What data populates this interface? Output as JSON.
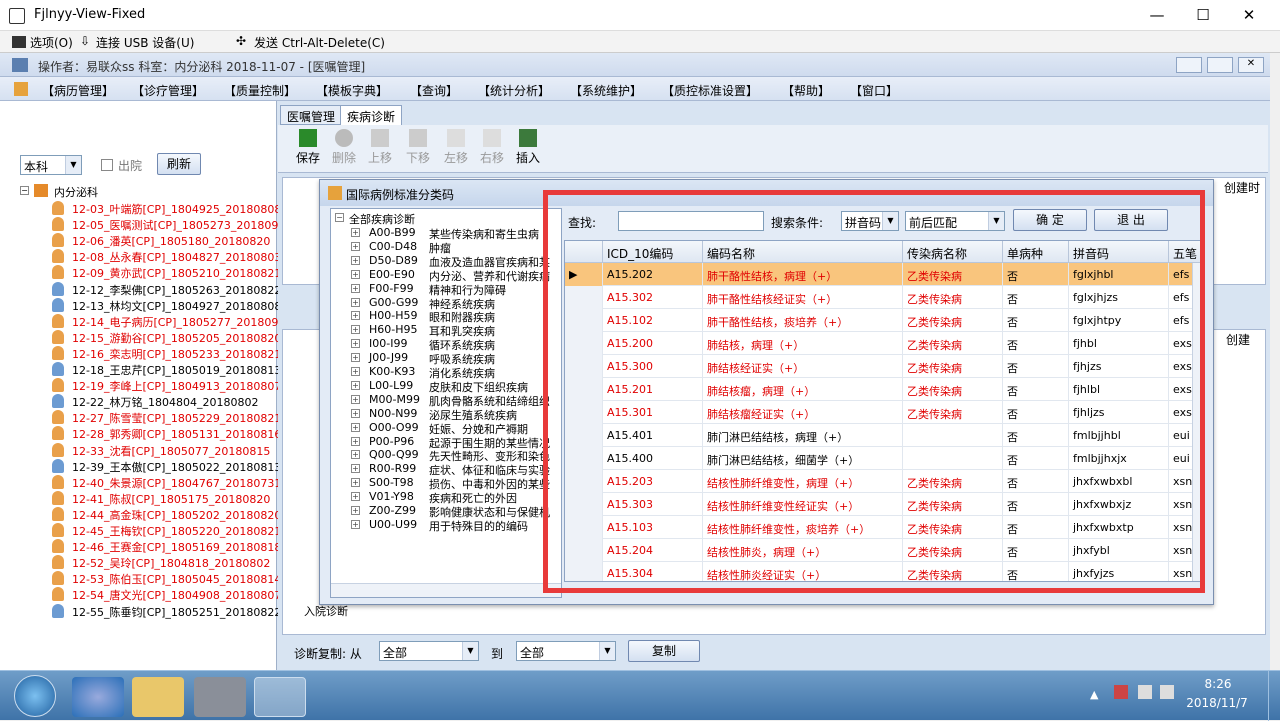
{
  "window": {
    "title": "Fjlnyy-View-Fixed",
    "min": "—",
    "max": "☐",
    "close": "✕"
  },
  "vnc": {
    "options": "选项(O)",
    "usb": "连接 USB 设备(U)",
    "cad": "发送 Ctrl-Alt-Delete(C)"
  },
  "info": {
    "text": "操作者：易联众ss   科室：内分泌科   2018-11-07 - [医嘱管理]"
  },
  "menu": [
    "【病历管理】",
    "【诊疗管理】",
    "【质量控制】",
    "【模板字典】",
    "【查询】",
    "【统计分析】",
    "【系统维护】",
    "【质控标准设置】",
    "【帮助】",
    "【窗口】"
  ],
  "left": {
    "dept_select": "本科",
    "discharged_label": "出院",
    "refresh_label": "刷新",
    "root": "内分泌科",
    "patients": [
      {
        "text": "12-03_叶端筋[CP]_1804925_20180808",
        "red": true
      },
      {
        "text": "12-05_医嘱测试[CP]_1805273_201809",
        "red": true
      },
      {
        "text": "12-06_潘英[CP]_1805180_20180820",
        "red": true
      },
      {
        "text": "12-08_丛永春[CP]_1804827_20180803",
        "red": true
      },
      {
        "text": "12-09_黄亦武[CP]_1805210_20180821",
        "red": true
      },
      {
        "text": "12-12_李梨佛[CP]_1805263_20180822",
        "red": false
      },
      {
        "text": "12-13_林均文[CP]_1804927_20180808",
        "red": false
      },
      {
        "text": "12-14_电子病历[CP]_1805277_201809",
        "red": true
      },
      {
        "text": "12-15_游勤谷[CP]_1805205_20180820",
        "red": true
      },
      {
        "text": "12-16_栾志明[CP]_1805233_20180821",
        "red": true
      },
      {
        "text": "12-18_王忠芹[CP]_1805019_20180813",
        "red": false
      },
      {
        "text": "12-19_李峰上[CP]_1804913_20180807",
        "red": true
      },
      {
        "text": "12-22_林万铭_1804804_20180802",
        "red": false
      },
      {
        "text": "12-27_陈雪莹[CP]_1805229_20180821",
        "red": true
      },
      {
        "text": "12-28_郭秀卿[CP]_1805131_20180816",
        "red": true
      },
      {
        "text": "12-33_沈看[CP]_1805077_20180815",
        "red": true
      },
      {
        "text": "12-39_王本傲[CP]_1805022_20180813",
        "red": false
      },
      {
        "text": "12-40_朱景源[CP]_1804767_20180731",
        "red": true
      },
      {
        "text": "12-41_陈叔[CP]_1805175_20180820",
        "red": true
      },
      {
        "text": "12-44_高金珠[CP]_1805202_20180820",
        "red": true
      },
      {
        "text": "12-45_王梅钦[CP]_1805220_20180821",
        "red": true
      },
      {
        "text": "12-46_王赛金[CP]_1805169_20180818",
        "red": true
      },
      {
        "text": "12-52_吴玲[CP]_1804818_20180802",
        "red": true
      },
      {
        "text": "12-53_陈伯玉[CP]_1805045_20180814",
        "red": true
      },
      {
        "text": "12-54_唐文光[CP]_1804908_20180807",
        "red": true
      },
      {
        "text": "12-55_陈垂钧[CP]_1805251_20180822",
        "red": false
      }
    ]
  },
  "right": {
    "tabs": [
      "医嘱管理",
      "疾病诊断"
    ],
    "toolbar": [
      "保存",
      "删除",
      "上移",
      "下移",
      "左移",
      "右移",
      "插入"
    ],
    "bg_header_right": "创建时",
    "bg_header_right2": "创建",
    "bottom_row_left": "入院诊断",
    "copy_label": "诊断复制: 从",
    "copy_from": "全部",
    "copy_to_label": "到",
    "copy_to": "全部",
    "copy_button": "复制"
  },
  "dialog": {
    "title": "国际病例标准分类码",
    "tree_root": "全部疾病诊断",
    "tree": [
      {
        "code": "A00-B99",
        "name": "某些传染病和寄生虫病"
      },
      {
        "code": "C00-D48",
        "name": "肿瘤"
      },
      {
        "code": "D50-D89",
        "name": "血液及造血器官疾病和某"
      },
      {
        "code": "E00-E90",
        "name": "内分泌、营养和代谢疾病"
      },
      {
        "code": "F00-F99",
        "name": "精神和行为障碍"
      },
      {
        "code": "G00-G99",
        "name": "神经系统疾病"
      },
      {
        "code": "H00-H59",
        "name": "眼和附器疾病"
      },
      {
        "code": "H60-H95",
        "name": "耳和乳突疾病"
      },
      {
        "code": "I00-I99",
        "name": "循环系统疾病"
      },
      {
        "code": "J00-J99",
        "name": "呼吸系统疾病"
      },
      {
        "code": "K00-K93",
        "name": "消化系统疾病"
      },
      {
        "code": "L00-L99",
        "name": "皮肤和皮下组织疾病"
      },
      {
        "code": "M00-M99",
        "name": "肌肉骨骼系统和结缔组织"
      },
      {
        "code": "N00-N99",
        "name": "泌尿生殖系统疾病"
      },
      {
        "code": "O00-O99",
        "name": "妊娠、分娩和产褥期"
      },
      {
        "code": "P00-P96",
        "name": "起源于围生期的某些情况"
      },
      {
        "code": "Q00-Q99",
        "name": "先天性畸形、变形和染色"
      },
      {
        "code": "R00-R99",
        "name": "症状、体征和临床与实验"
      },
      {
        "code": "S00-T98",
        "name": "损伤、中毒和外因的某些"
      },
      {
        "code": "V01-Y98",
        "name": "疾病和死亡的外因"
      },
      {
        "code": "Z00-Z99",
        "name": "影响健康状态和与保健机"
      },
      {
        "code": "U00-U99",
        "name": "用于特殊目的的编码"
      }
    ],
    "search_label": "查找:",
    "search_value": "",
    "cond_label": "搜索条件:",
    "cond_value": "拼音码",
    "match_value": "前后匹配",
    "ok": "确 定",
    "exit": "退 出",
    "columns": [
      "ICD_10编码",
      "编码名称",
      "传染病名称",
      "单病种",
      "拼音码",
      "五笔"
    ],
    "rows": [
      {
        "code": "A15.202",
        "name": "肺干酪性结核，病理（+）",
        "inf": "乙类传染病",
        "single": "否",
        "py": "fglxjhbl",
        "wb": "efs",
        "red": true,
        "sel": true
      },
      {
        "code": "A15.302",
        "name": "肺干酪性结核经证实（+）",
        "inf": "乙类传染病",
        "single": "否",
        "py": "fglxjhjzs",
        "wb": "efs",
        "red": true
      },
      {
        "code": "A15.102",
        "name": "肺干酪性结核，痰培养（+）",
        "inf": "乙类传染病",
        "single": "否",
        "py": "fglxjhtpy",
        "wb": "efs",
        "red": true
      },
      {
        "code": "A15.200",
        "name": "肺结核，病理（+）",
        "inf": "乙类传染病",
        "single": "否",
        "py": "fjhbl",
        "wb": "exs",
        "red": true
      },
      {
        "code": "A15.300",
        "name": "肺结核经证实（+）",
        "inf": "乙类传染病",
        "single": "否",
        "py": "fjhjzs",
        "wb": "exs",
        "red": true
      },
      {
        "code": "A15.201",
        "name": "肺结核瘤，病理（+）",
        "inf": "乙类传染病",
        "single": "否",
        "py": "fjhlbl",
        "wb": "exs",
        "red": true
      },
      {
        "code": "A15.301",
        "name": "肺结核瘤经证实（+）",
        "inf": "乙类传染病",
        "single": "否",
        "py": "fjhljzs",
        "wb": "exs",
        "red": true
      },
      {
        "code": "A15.401",
        "name": "肺门淋巴结结核，病理（+）",
        "inf": "",
        "single": "否",
        "py": "fmlbjjhbl",
        "wb": "eui",
        "red": false
      },
      {
        "code": "A15.400",
        "name": "肺门淋巴结结核，细菌学（+）",
        "inf": "",
        "single": "否",
        "py": "fmlbjjhxjx",
        "wb": "eui",
        "red": false
      },
      {
        "code": "A15.203",
        "name": "结核性肺纤维变性，病理（+）",
        "inf": "乙类传染病",
        "single": "否",
        "py": "jhxfxwbxbl",
        "wb": "xsn",
        "red": true
      },
      {
        "code": "A15.303",
        "name": "结核性肺纤维变性经证实（+）",
        "inf": "乙类传染病",
        "single": "否",
        "py": "jhxfxwbxjz",
        "wb": "xsn",
        "red": true
      },
      {
        "code": "A15.103",
        "name": "结核性肺纤维变性，痰培养（+）",
        "inf": "乙类传染病",
        "single": "否",
        "py": "jhxfxwbxtp",
        "wb": "xsn",
        "red": true
      },
      {
        "code": "A15.204",
        "name": "结核性肺炎，病理（+）",
        "inf": "乙类传染病",
        "single": "否",
        "py": "jhxfybl",
        "wb": "xsn",
        "red": true
      },
      {
        "code": "A15.304",
        "name": "结核性肺炎经证实（+）",
        "inf": "乙类传染病",
        "single": "否",
        "py": "jhxfyjzs",
        "wb": "xsn",
        "red": true
      }
    ]
  },
  "taskbar": {
    "time": "8:26",
    "date": "2018/11/7"
  }
}
